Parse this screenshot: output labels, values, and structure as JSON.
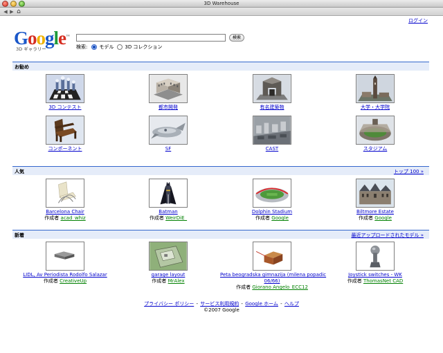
{
  "window": {
    "title": "3D Warehouse"
  },
  "toolbar": {
    "back": "◀",
    "forward": "▶",
    "home": "⌂"
  },
  "header": {
    "login": "ログイン",
    "logo_letters": [
      {
        "ch": "G",
        "color": "#1a57c9"
      },
      {
        "ch": "o",
        "color": "#d62d20"
      },
      {
        "ch": "o",
        "color": "#f0b200"
      },
      {
        "ch": "g",
        "color": "#1a57c9"
      },
      {
        "ch": "l",
        "color": "#1e9a3a"
      },
      {
        "ch": "e",
        "color": "#d62d20"
      }
    ],
    "logo_trademark": "™",
    "logo_sub": "3D ギャラリー",
    "search_value": "",
    "search_button": "検索",
    "search_label": "検索:",
    "option_models": "モデル",
    "option_collections": "3D コレクション"
  },
  "featured": {
    "label": "お勧め",
    "items": [
      {
        "title": "3D コンテスト",
        "icon": "chess-icon"
      },
      {
        "title": "都市開発",
        "icon": "city-block-icon"
      },
      {
        "title": "有名建築物",
        "icon": "arch-icon"
      },
      {
        "title": "大学・大学院",
        "icon": "campus-tower-icon"
      },
      {
        "title": "コンポーネント",
        "icon": "chair-icon"
      },
      {
        "title": "SF",
        "icon": "spaceship-icon"
      },
      {
        "title": "CAST",
        "icon": "cast-city-icon"
      },
      {
        "title": "スタジアム",
        "icon": "stadium-icon"
      }
    ]
  },
  "popular": {
    "label": "人気",
    "more": "トップ 100 »",
    "author_prefix": "作成者",
    "items": [
      {
        "title": "Barcelona Chair",
        "author": "acad_whiz"
      },
      {
        "title": "Batman",
        "author": "WeirDiE_"
      },
      {
        "title": "Dolphin Stadium",
        "author": "Google"
      },
      {
        "title": "Biltmore Estate",
        "author": "Google"
      }
    ]
  },
  "new": {
    "label": "新着",
    "more": "最近アップロードされたモデル »",
    "author_prefix": "作成者",
    "items": [
      {
        "title": "LIDL, Av Periodista Rodolfo Salazar",
        "author": "CreativeUp"
      },
      {
        "title": "garage layout",
        "author": "MrAlex"
      },
      {
        "title": "Peta beogradska gimnazija (milena popadic",
        "title2": "06/66)",
        "author": "Giorano Angelo_ECC12"
      },
      {
        "title": "Joystick switches - WK",
        "author": "ThomasNet CAD"
      }
    ]
  },
  "footer": {
    "privacy": "プライバシー ポリシー",
    "sep": " - ",
    "terms": "サービス利用規約",
    "home": "Google ホーム",
    "help": "ヘルプ",
    "copyright": "©2007 Google"
  }
}
